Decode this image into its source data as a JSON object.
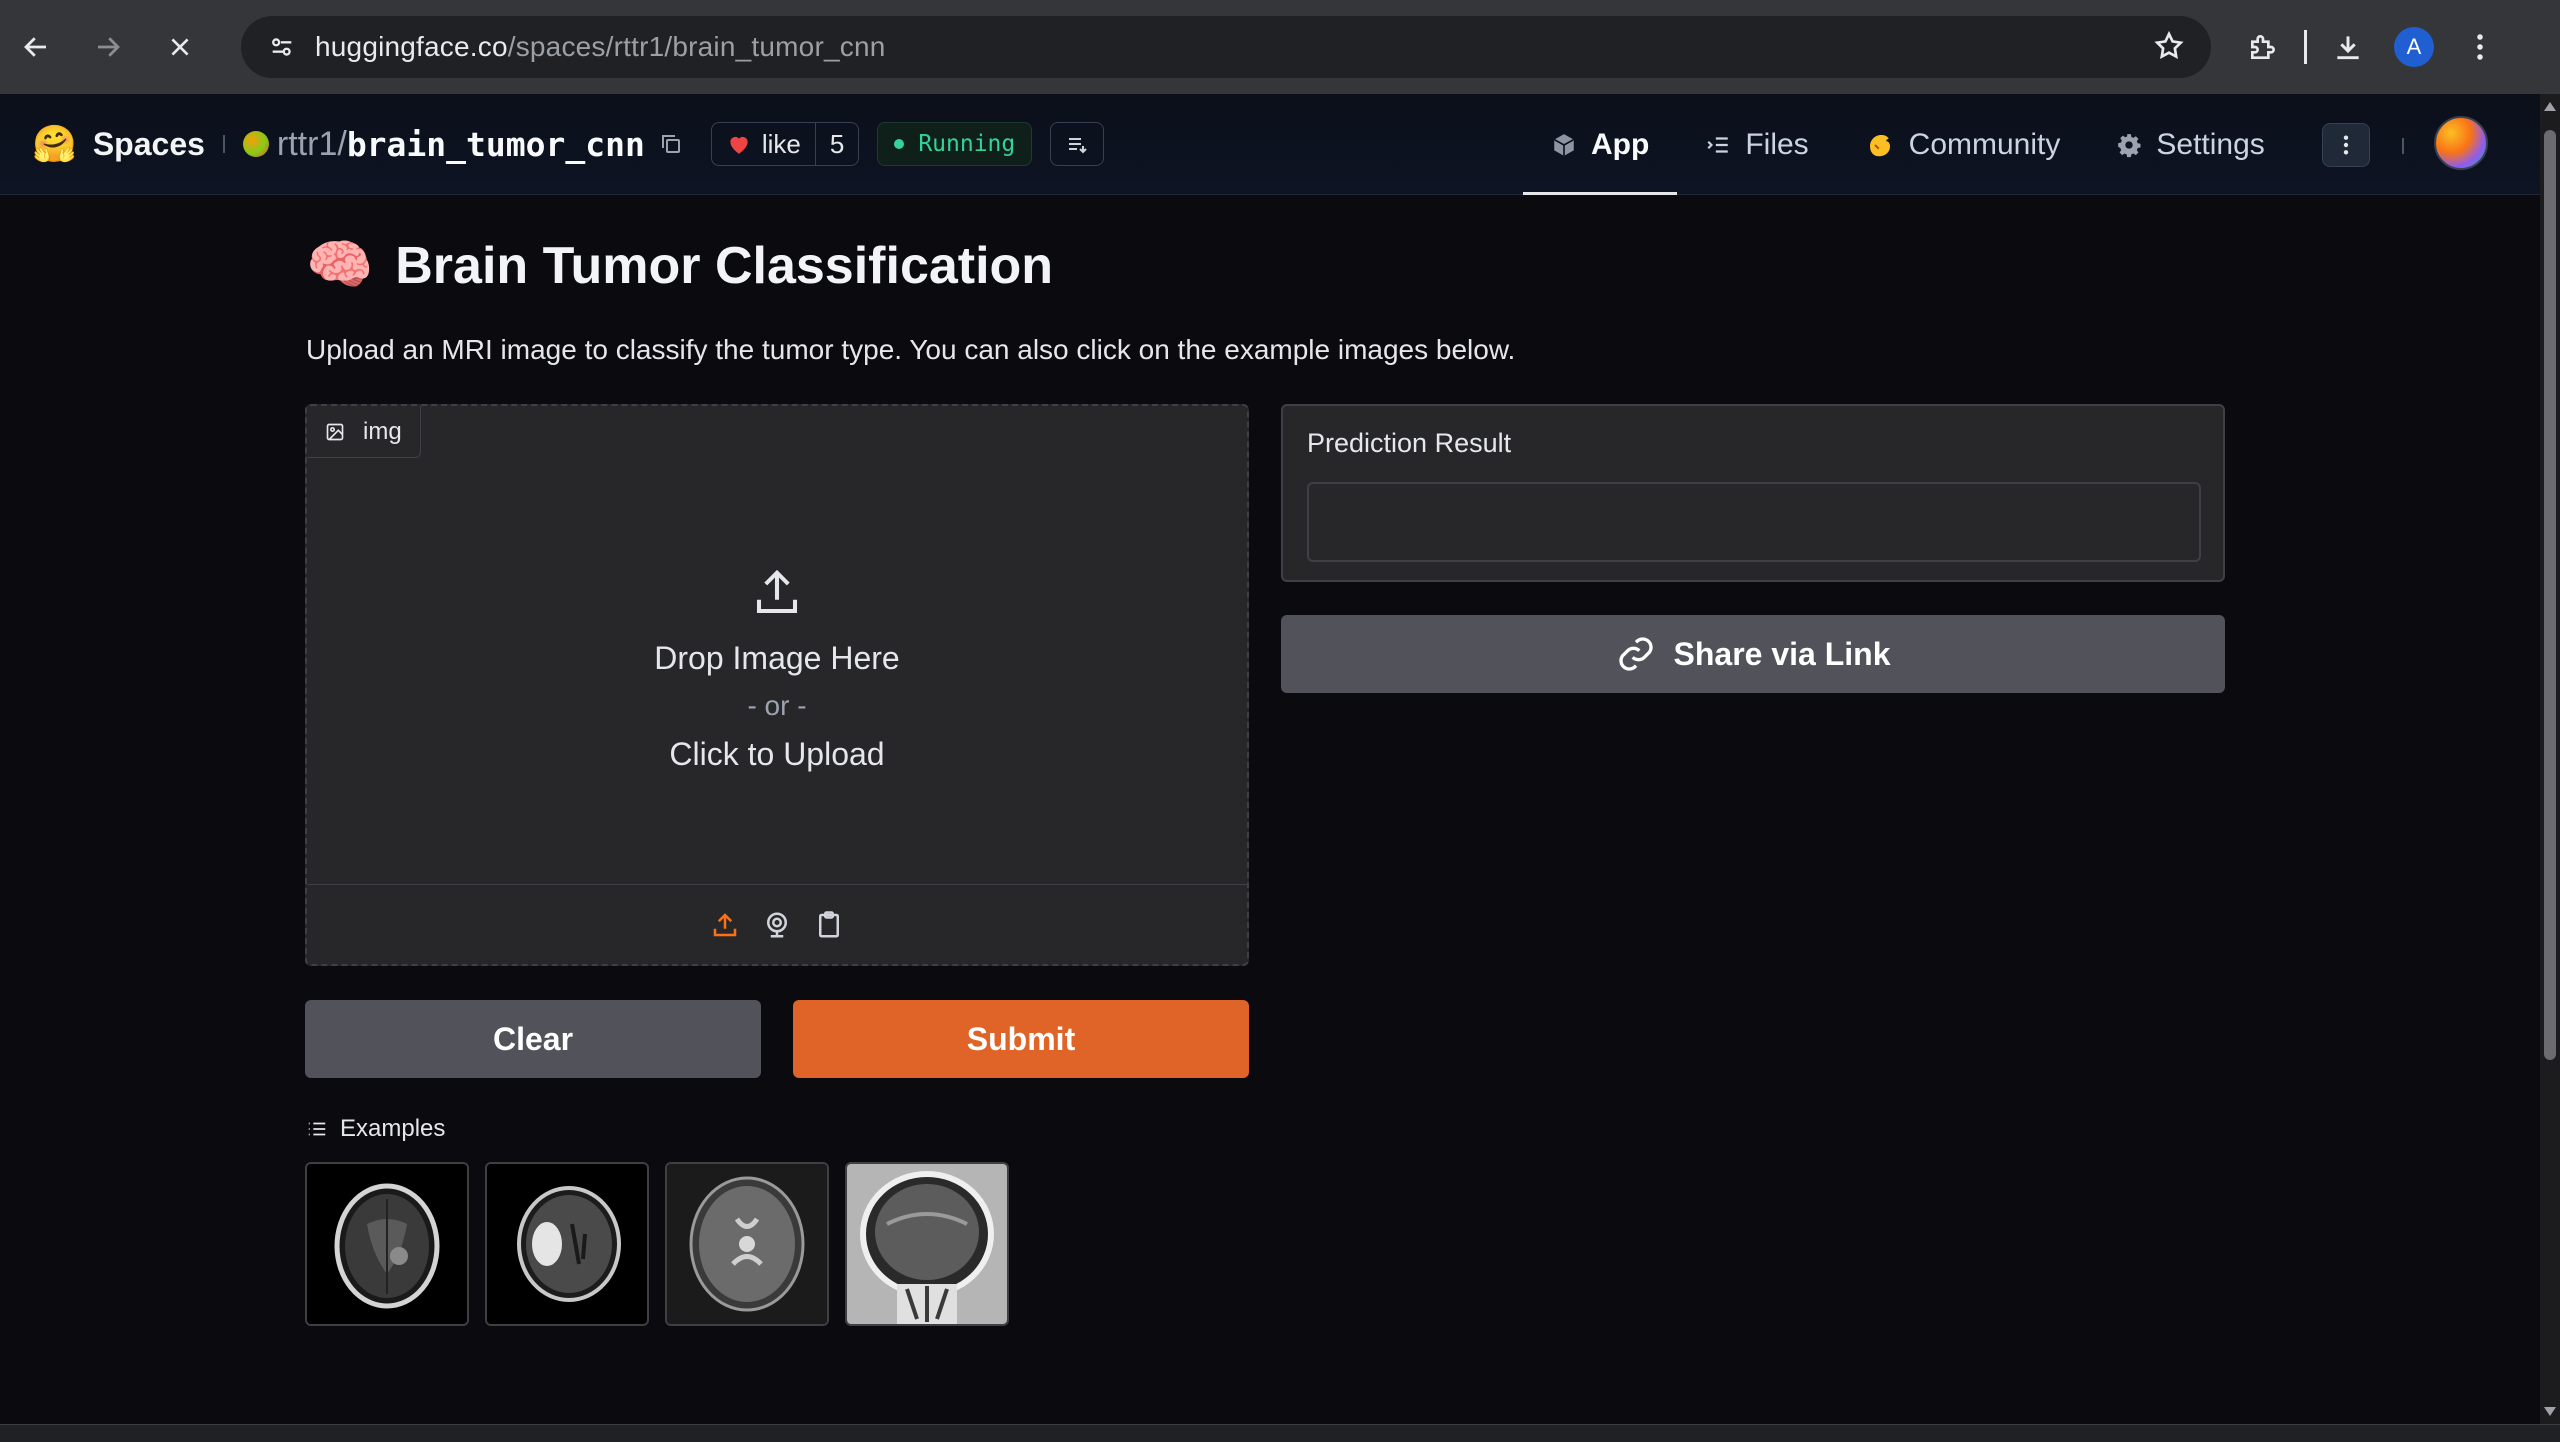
{
  "browser": {
    "url_host": "huggingface.co",
    "url_path": "/spaces/rttr1/brain_tumor_cnn",
    "profile_initial": "A"
  },
  "header": {
    "spaces_label": "Spaces",
    "owner": "rttr1",
    "slash": "/",
    "repo_name": "brain_tumor_cnn",
    "like_label": "like",
    "like_count": "5",
    "status": "Running",
    "tabs": [
      {
        "label": "App",
        "icon": "cube-icon",
        "active": true
      },
      {
        "label": "Files",
        "icon": "files-icon",
        "active": false
      },
      {
        "label": "Community",
        "icon": "community-icon",
        "active": false
      },
      {
        "label": "Settings",
        "icon": "gear-icon",
        "active": false
      }
    ]
  },
  "app": {
    "title_emoji": "🧠",
    "title": "Brain Tumor Classification",
    "description": "Upload an MRI image to classify the tumor type. You can also click on the example images below.",
    "image_input": {
      "label": "img",
      "drop_text": "Drop Image Here",
      "or_text": "- or -",
      "click_text": "Click to Upload"
    },
    "clear_label": "Clear",
    "submit_label": "Submit",
    "examples_label": "Examples",
    "prediction_label": "Prediction Result",
    "prediction_value": "",
    "share_label": "Share via Link"
  },
  "colors": {
    "accent_orange": "#e06428",
    "running_green": "#34d399",
    "like_red": "#ef4444"
  }
}
